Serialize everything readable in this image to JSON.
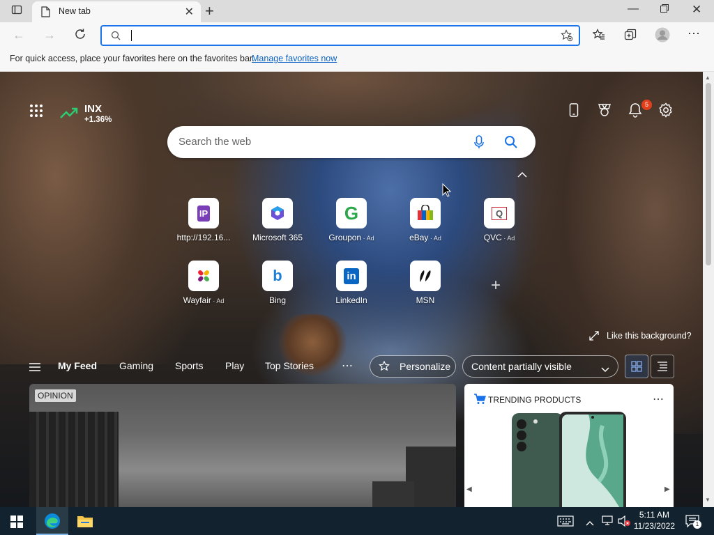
{
  "browser": {
    "tab_title": "New tab",
    "favorites_message": "For quick access, place your favorites here on the favorites bar.",
    "favorites_link": "Manage favorites now"
  },
  "ntp": {
    "stock": {
      "symbol": "INX",
      "change": "+1.36%"
    },
    "notification_count": "5",
    "search_placeholder": "Search the web",
    "quick_links": [
      {
        "label": "http://192.16...",
        "ad": "",
        "icon": "ip-icon"
      },
      {
        "label": "Microsoft 365",
        "ad": "",
        "icon": "microsoft-365-icon"
      },
      {
        "label": "Groupon",
        "ad": " · Ad",
        "icon": "groupon-icon"
      },
      {
        "label": "eBay",
        "ad": " · Ad",
        "icon": "ebay-icon"
      },
      {
        "label": "QVC",
        "ad": " · Ad",
        "icon": "qvc-icon"
      },
      {
        "label": "Wayfair",
        "ad": " · Ad",
        "icon": "wayfair-icon"
      },
      {
        "label": "Bing",
        "ad": "",
        "icon": "bing-icon"
      },
      {
        "label": "LinkedIn",
        "ad": "",
        "icon": "linkedin-icon"
      },
      {
        "label": "MSN",
        "ad": "",
        "icon": "msn-icon"
      }
    ],
    "like_background": "Like this background?",
    "feed_nav": [
      "My Feed",
      "Gaming",
      "Sports",
      "Play",
      "Top Stories"
    ],
    "personalize": "Personalize",
    "content_visibility": "Content partially visible",
    "opinion_badge": "OPINION",
    "trending_title": "TRENDING PRODUCTS"
  },
  "taskbar": {
    "time": "5:11 AM",
    "date": "11/23/2022",
    "notification_count": "1"
  }
}
